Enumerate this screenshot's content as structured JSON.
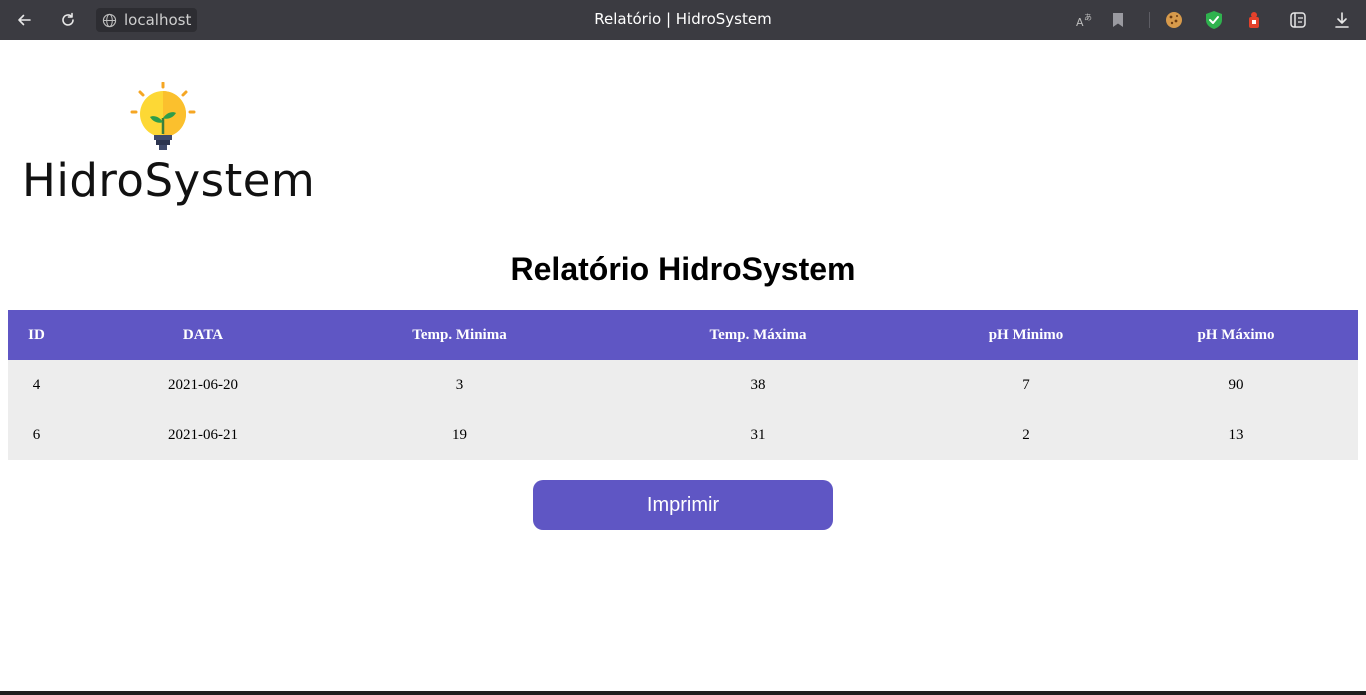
{
  "browser": {
    "url": "localhost",
    "tab_title": "Relatório | HidroSystem"
  },
  "logo": {
    "text": "HidroSystem"
  },
  "page": {
    "title": "Relatório HidroSystem"
  },
  "table": {
    "headers": [
      "ID",
      "DATA",
      "Temp. Minima",
      "Temp. Máxima",
      "pH Minimo",
      "pH Máximo"
    ],
    "rows": [
      [
        "4",
        "2021-06-20",
        "3",
        "38",
        "7",
        "90"
      ],
      [
        "6",
        "2021-06-21",
        "19",
        "31",
        "2",
        "13"
      ]
    ]
  },
  "actions": {
    "print_label": "Imprimir"
  },
  "colors": {
    "accent": "#5f56c4",
    "row_bg": "#ededed",
    "chrome_bg": "#3b3b41"
  },
  "icons": [
    "back-arrow-icon",
    "reload-icon",
    "globe-icon",
    "translate-icon",
    "bookmark-icon",
    "cookie-icon",
    "shield-check-icon",
    "extension-icon",
    "collections-icon",
    "download-icon"
  ]
}
